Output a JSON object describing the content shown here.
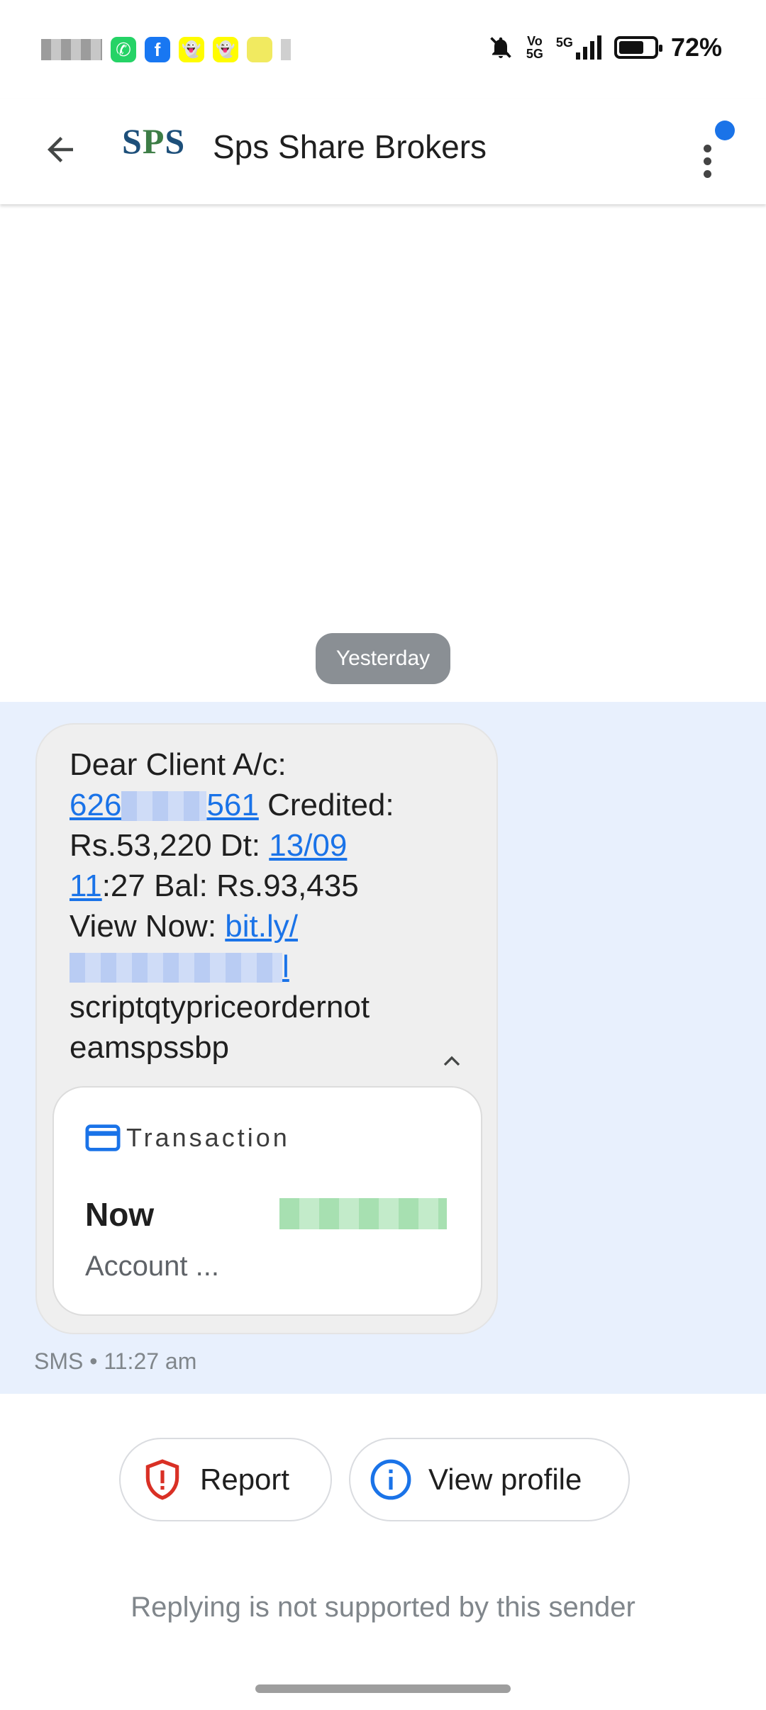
{
  "status_bar": {
    "network_small_top": "Vo",
    "network_small_bottom": "5G",
    "network_type": "5G",
    "battery_percent": 72,
    "battery_text": "72%"
  },
  "header": {
    "logo_s1": "S",
    "logo_p": "P",
    "logo_s2": "S",
    "contact_name": "Sps Share Brokers"
  },
  "conversation": {
    "date_chip": "Yesterday",
    "message": {
      "line1": "Dear Client A/c:",
      "account_prefix": "626",
      "account_suffix": "561",
      "credited_text": " Credited:",
      "amount_text": "Rs.53,220 Dt: ",
      "date_link_part1": "13/09",
      "date_link_part2": "11",
      "time_balance_text": ":27 Bal: Rs.93,435",
      "view_now_text": "View Now: ",
      "link_text": "bit.ly/",
      "link_tail": "l",
      "trailing_text": "scriptqtypriceordernot eamspssbp"
    },
    "transaction_card": {
      "label": "Transaction",
      "time": "Now",
      "subtitle": "Account ..."
    },
    "meta": "SMS • 11:27 am"
  },
  "actions": {
    "report_label": "Report",
    "view_profile_label": "View profile"
  },
  "footer": {
    "no_reply_text": "Replying is not supported by this sender"
  },
  "colors": {
    "accent": "#1a73e8",
    "selected_band": "#e8f0fd",
    "bubble": "#efefef",
    "report_red": "#d93025"
  }
}
